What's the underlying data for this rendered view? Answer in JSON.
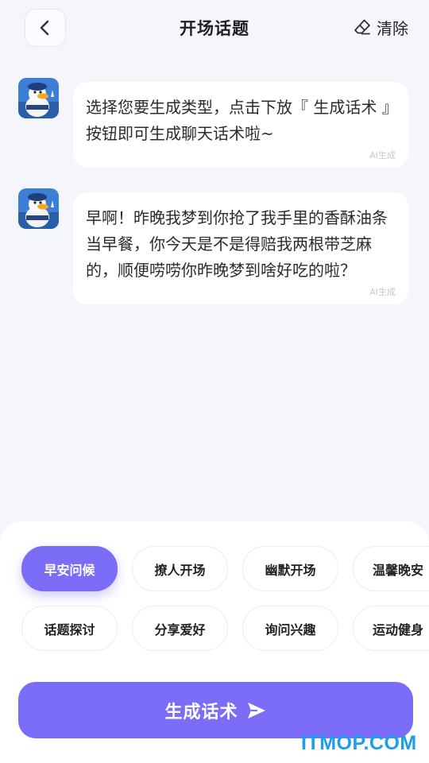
{
  "header": {
    "title": "开场话题",
    "clear_label": "清除"
  },
  "messages": [
    {
      "text": "选择您要生成类型，点击下放『 生成话术 』按钮即可生成聊天话术啦~",
      "tag": "AI生成"
    },
    {
      "text": "早啊！昨晚我梦到你抢了我手里的香酥油条当早餐，你今天是不是得赔我两根带芝麻的，顺便唠唠你昨晚梦到啥好吃的啦？",
      "tag": "AI生成"
    }
  ],
  "categories": [
    {
      "label": "早安问候",
      "active": true
    },
    {
      "label": "撩人开场",
      "active": false
    },
    {
      "label": "幽默开场",
      "active": false
    },
    {
      "label": "温馨晚安",
      "active": false
    },
    {
      "label": "话题探讨",
      "active": false
    },
    {
      "label": "分享爱好",
      "active": false
    },
    {
      "label": "询问兴趣",
      "active": false
    },
    {
      "label": "运动健身",
      "active": false
    }
  ],
  "generate_button": {
    "label": "生成话术"
  },
  "watermark": "ITMOP.COM",
  "colors": {
    "accent": "#7b6df7",
    "background": "#f5f5fc",
    "watermark": "#1a9fe8"
  }
}
